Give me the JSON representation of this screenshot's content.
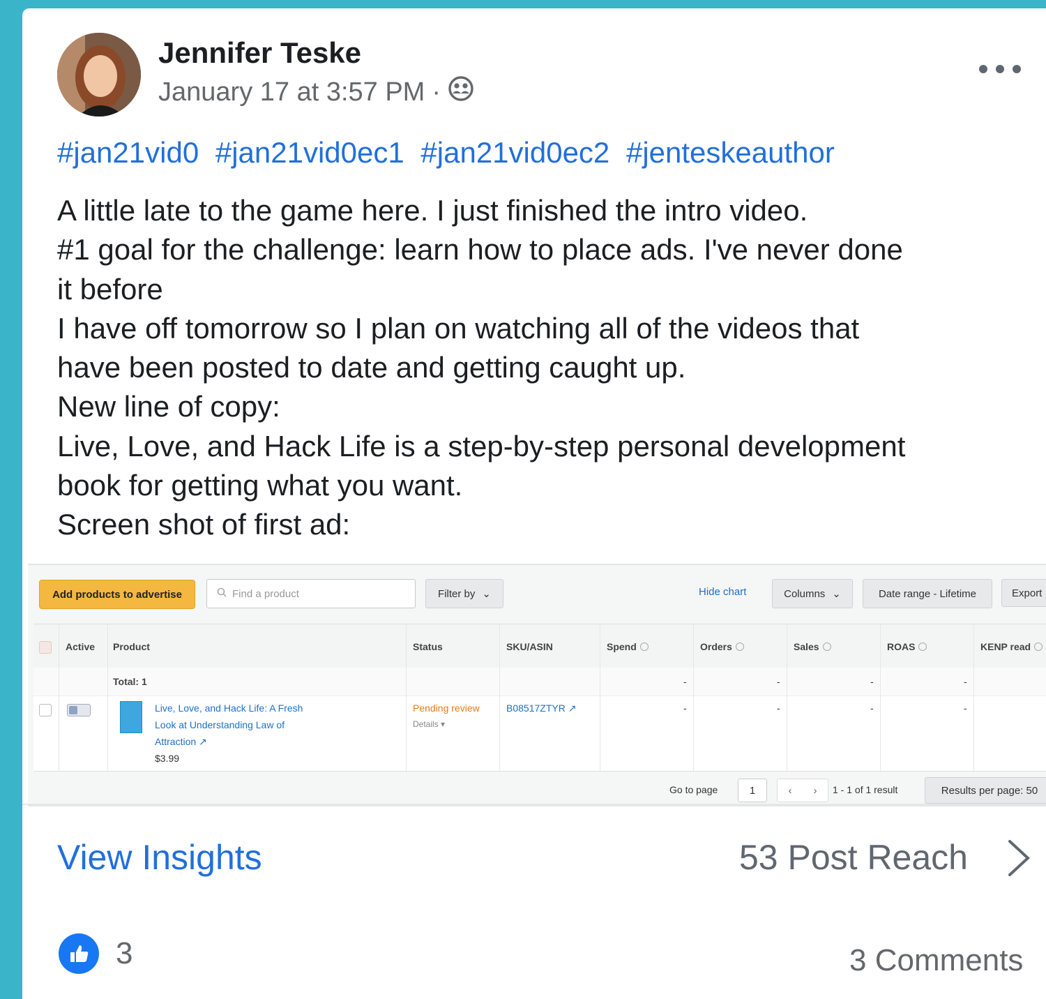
{
  "post": {
    "author": "Jennifer Teske",
    "timestamp": "January 17 at 3:57 PM",
    "audience_separator": "·",
    "audience_icon": "group-icon",
    "more_icon": "more-dots-icon",
    "hashtags": [
      "#jan21vid0",
      "#jan21vid0ec1",
      "#jan21vid0ec2",
      "#jenteskeauthor"
    ],
    "body_lines": [
      "A little late to the game here. I just finished the intro video.",
      "#1 goal for the challenge: learn how to place ads. I've never done",
      "it before",
      "I have off tomorrow so I plan on watching all of the videos that",
      "have been posted to date and getting caught up.",
      "New line of copy:",
      "Live, Love, and Hack Life is a step-by-step personal development",
      "book for getting what you want.",
      "Screen shot of first ad:"
    ]
  },
  "ad_screenshot": {
    "add_button": "Add products to advertise",
    "search_placeholder": "Find a product",
    "filter": "Filter by",
    "hide_chart": "Hide chart",
    "columns": "Columns",
    "date_range": "Date range - Lifetime",
    "export": "Export",
    "headers": {
      "active": "Active",
      "product": "Product",
      "status": "Status",
      "sku": "SKU/ASIN",
      "spend": "Spend",
      "orders": "Orders",
      "sales": "Sales",
      "roas": "ROAS",
      "kenp": "KENP read"
    },
    "total": "Total: 1",
    "dash": "-",
    "row": {
      "title_lines": [
        "Live, Love, and Hack Life: A Fresh",
        "Look at Understanding Law of",
        "Attraction"
      ],
      "price": "$3.99",
      "status": "Pending review",
      "details": "Details",
      "sku": "B08517ZTYR"
    },
    "go_to_page": "Go to page",
    "page_number": "1",
    "result_text": "1 - 1 of 1 result",
    "results_per_page": "Results per page: 50"
  },
  "footer": {
    "view_insights": "View Insights",
    "post_reach": "53 Post Reach",
    "like_count": "3",
    "comments": "3 Comments"
  },
  "colors": {
    "background": "#3ab4c9",
    "link": "#216fdb",
    "like_blue": "#1877f2",
    "ad_yellow": "#f4b73f",
    "pending_orange": "#e77b17"
  }
}
